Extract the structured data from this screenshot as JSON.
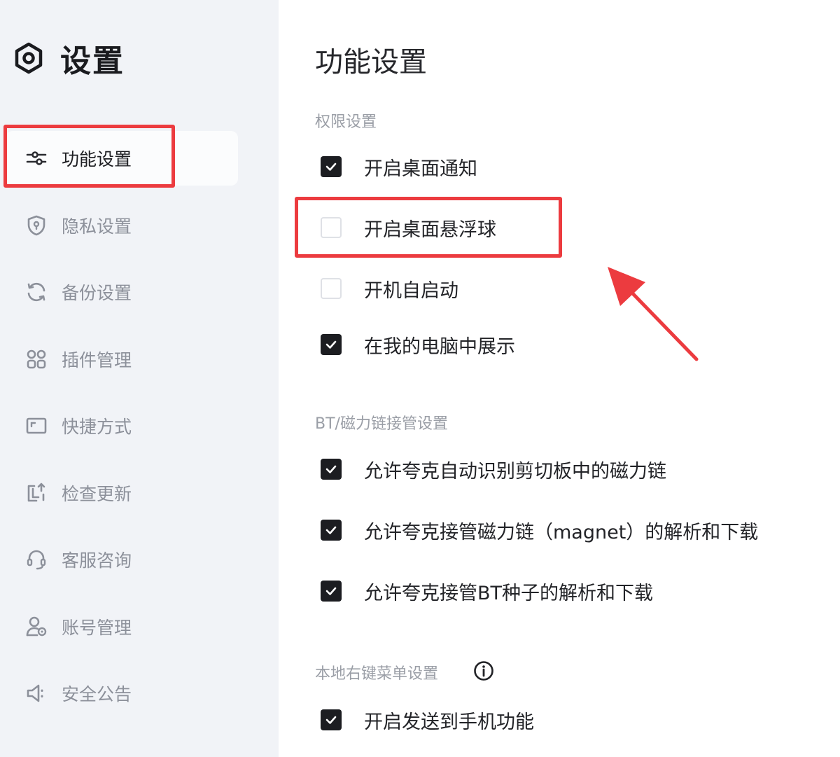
{
  "sidebar": {
    "title": "设置",
    "items": [
      {
        "label": "功能设置",
        "icon": "sliders-icon",
        "active": true
      },
      {
        "label": "隐私设置",
        "icon": "shield-icon"
      },
      {
        "label": "备份设置",
        "icon": "sync-icon"
      },
      {
        "label": "插件管理",
        "icon": "grid-icon"
      },
      {
        "label": "快捷方式",
        "icon": "shortcut-icon"
      },
      {
        "label": "检查更新",
        "icon": "update-icon"
      },
      {
        "label": "客服咨询",
        "icon": "headset-icon"
      },
      {
        "label": "账号管理",
        "icon": "user-settings-icon"
      },
      {
        "label": "安全公告",
        "icon": "megaphone-icon"
      }
    ]
  },
  "main": {
    "title": "功能设置",
    "sections": [
      {
        "title": "权限设置",
        "options": [
          {
            "label": "开启桌面通知",
            "checked": true
          },
          {
            "label": "开启桌面悬浮球",
            "checked": false
          },
          {
            "label": "开机自启动",
            "checked": false
          },
          {
            "label": "在我的电脑中展示",
            "checked": true
          }
        ]
      },
      {
        "title": "BT/磁力链接管设置",
        "options": [
          {
            "label": "允许夸克自动识别剪切板中的磁力链",
            "checked": true
          },
          {
            "label": "允许夸克接管磁力链（magnet）的解析和下载",
            "checked": true
          },
          {
            "label": "允许夸克接管BT种子的解析和下载",
            "checked": true
          }
        ]
      },
      {
        "title": "本地右键菜单设置",
        "info_icon": "info-icon",
        "options": [
          {
            "label": "开启发送到手机功能",
            "checked": true
          }
        ]
      }
    ]
  },
  "annotation": {
    "color": "#ec3b3f"
  }
}
